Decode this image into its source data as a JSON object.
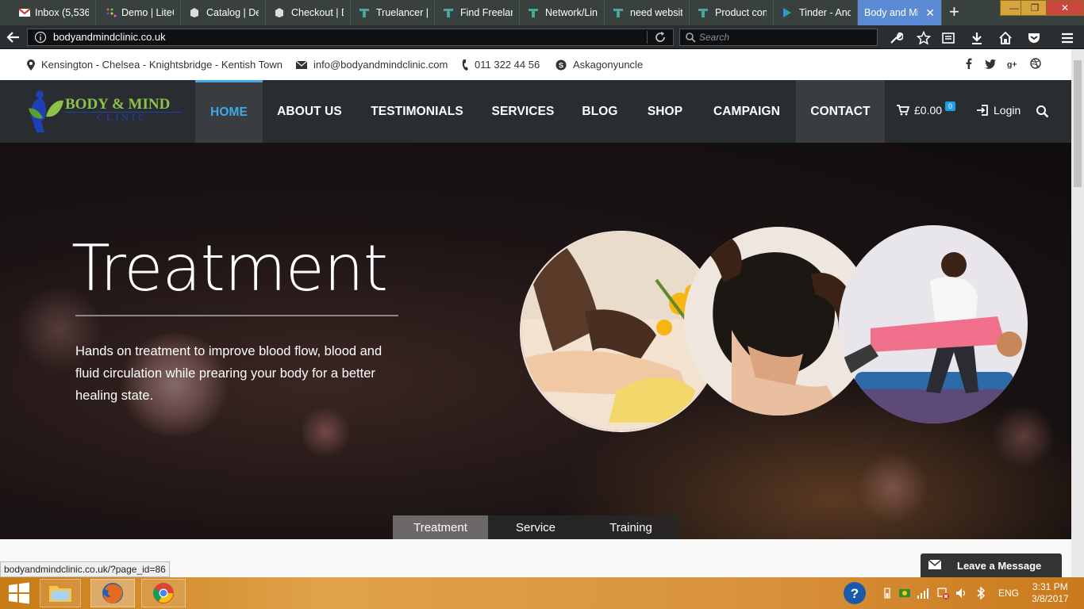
{
  "browser": {
    "tabs": [
      {
        "label": "Inbox (5,536)",
        "icon": "gmail-icon"
      },
      {
        "label": "Demo | LiteC",
        "icon": "dots-icon"
      },
      {
        "label": "Catalog | De",
        "icon": "box-icon"
      },
      {
        "label": "Checkout | D",
        "icon": "box-icon"
      },
      {
        "label": "Truelancer |",
        "icon": "truelancer-icon"
      },
      {
        "label": "Find Freelan",
        "icon": "truelancer-icon"
      },
      {
        "label": "Network/Lin",
        "icon": "truelancer-icon"
      },
      {
        "label": "need websit",
        "icon": "truelancer-icon"
      },
      {
        "label": "Product con",
        "icon": "truelancer-icon"
      },
      {
        "label": "Tinder - And",
        "icon": "play-store-icon"
      },
      {
        "label": "Body and Mi",
        "icon": "none",
        "active": true
      }
    ],
    "url": "bodyandmindclinic.co.uk",
    "search_placeholder": "Search"
  },
  "topbar": {
    "location": "Kensington - Chelsea - Knightsbridge - Kentish Town",
    "email": "info@bodyandmindclinic.com",
    "phone": "011 322 44 56",
    "skype": "Askagonyuncle",
    "social": [
      "facebook-icon",
      "twitter-icon",
      "google-plus-icon",
      "dribbble-icon"
    ]
  },
  "logo": {
    "line1": "BODY & MIND",
    "line2": "CLINIC"
  },
  "nav": {
    "items": [
      "HOME",
      "ABOUT US",
      "TESTIMONIALS",
      "SERVICES",
      "BLOG",
      "SHOP",
      "CAMPAIGN",
      "CONTACT"
    ],
    "active": "HOME",
    "cart_total": "£0.00",
    "cart_count": "0",
    "login": "Login"
  },
  "hero": {
    "title": "Treatment",
    "text": "Hands on treatment to improve blood flow, blood and fluid circulation while prearing your body for a better healing state.",
    "tabs": [
      "Treatment",
      "Service",
      "Training"
    ],
    "active_tab": "Treatment"
  },
  "status_url": "bodyandmindclinic.co.uk/?page_id=86",
  "chat": {
    "label": "Leave a Message"
  },
  "taskbar": {
    "lang": "ENG",
    "time": "3:31 PM",
    "date": "3/8/2017"
  },
  "colors": {
    "accent": "#3fa9e6",
    "nav_bg": "#292c31",
    "logo_green": "#8bc34a",
    "logo_blue": "#1f3fb5"
  }
}
